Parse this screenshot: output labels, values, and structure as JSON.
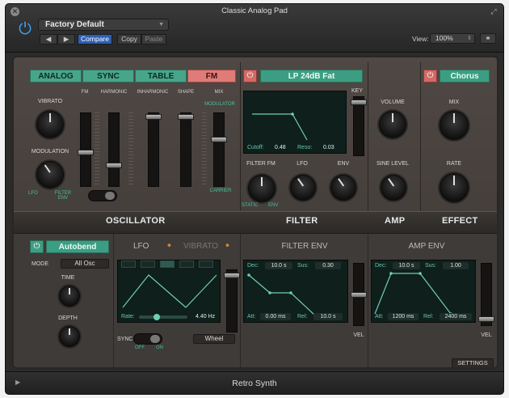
{
  "window": {
    "title": "Classic Analog Pad",
    "footer_title": "Retro Synth"
  },
  "toolbar": {
    "preset": "Factory Default",
    "compare": "Compare",
    "copy": "Copy",
    "paste": "Paste",
    "view_label": "View:",
    "view_value": "100%"
  },
  "oscillator": {
    "tabs": [
      "ANALOG",
      "SYNC",
      "TABLE",
      "FM"
    ],
    "active_tab": "FM",
    "vibrato_label": "VIBRATO",
    "modulation_label": "MODULATION",
    "lfo_label": "LFO",
    "filter_env_label": "FILTER ENV",
    "slider_labels": [
      "FM",
      "HARMONIC",
      "INHARMONIC",
      "SHAPE",
      "MIX"
    ],
    "modulator_label": "MODULATOR",
    "carrier_label": "CARRIER",
    "section_label": "OSCILLATOR"
  },
  "filter": {
    "type": "LP 24dB Fat",
    "key_label": "KEY",
    "cutoff_label": "Cutoff:",
    "cutoff_value": "0.48",
    "reso_label": "Reso:",
    "reso_value": "0.03",
    "filter_fm_label": "FILTER FM",
    "lfo_label": "LFO",
    "env_label": "ENV",
    "static_label": "STATIC",
    "env2_label": "ENV",
    "section_label": "FILTER"
  },
  "amp": {
    "volume_label": "VOLUME",
    "sine_level_label": "SINE LEVEL",
    "section_label": "AMP"
  },
  "effect": {
    "type": "Chorus",
    "mix_label": "MIX",
    "rate_label": "RATE",
    "section_label": "EFFECT"
  },
  "glide": {
    "mode_button": "Autobend",
    "mode_label": "MODE",
    "mode_value": "All Osc",
    "time_label": "TIME",
    "depth_label": "DEPTH"
  },
  "lfo": {
    "tab_lfo": "LFO",
    "tab_vibrato": "VIBRATO",
    "rate_label": "Rate:",
    "rate_value": "4.40 Hz",
    "sync_label": "SYNC",
    "off_label": "OFF",
    "on_label": "ON",
    "wheel_label": "Wheel"
  },
  "filter_env": {
    "title": "FILTER ENV",
    "dec_label": "Dec:",
    "dec_value": "10.0 s",
    "sus_label": "Sus:",
    "sus_value": "0.30",
    "att_label": "Att:",
    "att_value": "0.00 ms",
    "rel_label": "Rel:",
    "rel_value": "10.0 s",
    "vel_label": "VEL"
  },
  "amp_env": {
    "title": "AMP ENV",
    "dec_label": "Dec:",
    "dec_value": "10.0 s",
    "sus_label": "Sus:",
    "sus_value": "1.00",
    "att_label": "Att:",
    "att_value": "1200 ms",
    "rel_label": "Rel:",
    "rel_value": "2400 ms",
    "vel_label": "VEL"
  },
  "settings_button": "SETTINGS",
  "colors": {
    "teal": "#47a58a",
    "salmon": "#e07b78",
    "blue": "#3aa0f5"
  }
}
